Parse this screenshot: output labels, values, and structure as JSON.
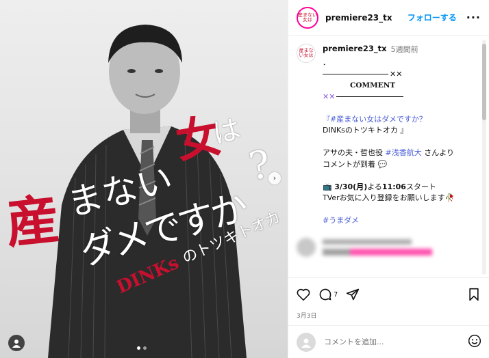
{
  "post_image": {
    "title_san": "産",
    "title_manai": "まない",
    "title_onna": "女",
    "title_ha": "は",
    "title_qmark": "?",
    "title_dame": "ダメですか",
    "subtitle_dinks": "DINKs",
    "subtitle_tsukito": "のトツキトオカ",
    "carousel_next_icon": "chevron-right-icon",
    "carousel_total": 2,
    "carousel_active": 1
  },
  "header": {
    "username": "premiere23_tx",
    "follow_label": "フォローする",
    "more_label": "···",
    "avatar_text": "産まない女は"
  },
  "caption": {
    "username": "premiere23_tx",
    "time": "5週間前",
    "line_dot": "．",
    "deco_xx": "✕✕",
    "comment_title": "COMMENT",
    "line_title": "『#産まない女はダメですか？",
    "line_title2": "DINKsのトツキトオカ 』",
    "line_role_prefix": "アサの夫・哲也役 ",
    "line_role_tag": "#浅香航大",
    "line_role_suffix": " さんより",
    "line_comment_arrival": "コメントが到着 💬",
    "line_schedule_date": "3/30(月)",
    "line_schedule_mid": "よる",
    "line_schedule_time": "11:06",
    "line_schedule_suffix": "スタート",
    "line_tver": "TVerお気に入り登録をお願いします🥀",
    "hashtag": "#うまダメ"
  },
  "actions": {
    "comment_count": "7",
    "date": "3月3日"
  },
  "add_comment": {
    "placeholder": "コメントを追加..."
  },
  "colors": {
    "accent_blue": "#0095f6",
    "hashtag_blue": "#4a5dd6",
    "title_red": "#c8102e"
  }
}
